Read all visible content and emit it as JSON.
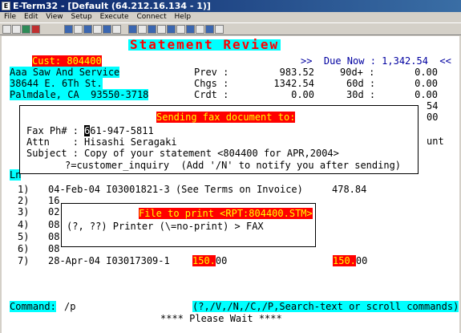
{
  "window": {
    "title": "E-Term32 - [Default (64.212.16.134 - 1)]"
  },
  "menu": [
    "File",
    "Edit",
    "View",
    "Setup",
    "Execute",
    "Connect",
    "Help"
  ],
  "screen": {
    "title": "Statement Review",
    "cust": "Cust: 804400",
    "due": ">>  Due Now : 1,342.54  <<",
    "addr1": "Aaa Saw And Service",
    "addr2": "38644 E. 6Th St.",
    "addr3": "Palmdale, CA  93550-3718",
    "prev_label": "Prev :",
    "prev_val": "983.52",
    "chgs_label": "Chgs :",
    "chgs_val": "1342.54",
    "crdt_label": "Crdt :",
    "crdt_val": "0.00",
    "d90_label": "90d+ :",
    "d90_val": "0.00",
    "d60_label": "60d :",
    "d60_val": "0.00",
    "d30_label": "30d :",
    "d30_val": "0.00",
    "right54": "54",
    "right00": "00",
    "right_unt": "unt",
    "ln": "Ln",
    "rows": [
      {
        "n": "1)",
        "text": "04-Feb-04 I03001821-3 (See Terms on Invoice)",
        "amt": "478.84"
      },
      {
        "n": "2)",
        "text": "16"
      },
      {
        "n": "3)",
        "text": "02"
      },
      {
        "n": "4)",
        "text": "08"
      },
      {
        "n": "5)",
        "text": "08"
      },
      {
        "n": "6)",
        "text": "08"
      },
      {
        "n": "7)",
        "text": "28-Apr-04 I03017309-1"
      }
    ],
    "row7_amt_hl": "150.",
    "row7_amt_rest": "00",
    "row7_amt2_hl": "150.",
    "row7_amt2_rest": "00",
    "command_label": "Command:",
    "command_value": "/p",
    "command_help": "(?,/V,/N,/C,/P,Search-text or scroll commands)",
    "status": "**** Please Wait ****"
  },
  "fax": {
    "heading": "Sending fax document to:",
    "faxph_label": "Fax Ph# :",
    "faxph_cursor": "6",
    "faxph_value": "61-947-5811",
    "attn_label": "Attn    :",
    "attn_value": "Hisashi Seragaki",
    "subject_label": "Subject :",
    "subject_value": "Copy of your statement <804400 for APR,2004>",
    "hint": "?=customer_inquiry  (Add '/N' to notify you after sending)"
  },
  "print": {
    "heading": "File to print <RPT:804400.STM>",
    "prompt": "(?, ??) Printer (\\=no-print) > FAX"
  }
}
